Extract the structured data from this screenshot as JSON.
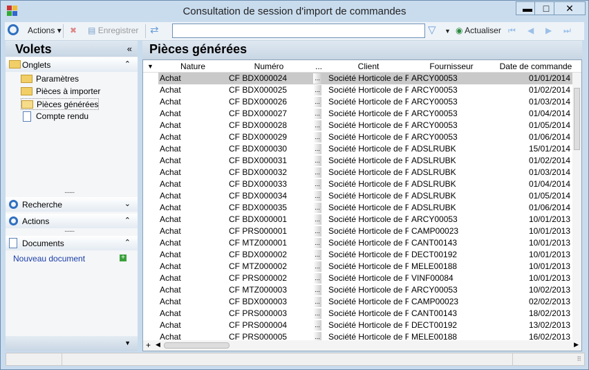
{
  "window": {
    "title": "Consultation de session d'import de commandes",
    "minimize": "▬",
    "maximize": "□",
    "close": "✕"
  },
  "toolbar": {
    "actions": "Actions",
    "delete": "✖",
    "save": "Enregistrer",
    "refresh": "Actualiser",
    "search_value": "",
    "search_placeholder": ""
  },
  "left": {
    "title": "Volets",
    "collapse": "«",
    "onglets": "Onglets",
    "tree": [
      "Paramètres",
      "Pièces à importer",
      "Pièces générées",
      "Compte rendu"
    ],
    "recherche": "Recherche",
    "actions": "Actions",
    "documents": "Documents",
    "new_document": "Nouveau document"
  },
  "main": {
    "title": "Pièces générées",
    "columns": [
      "Nature",
      "Numéro",
      "...",
      "Client",
      "Fournisseur",
      "Date de commande"
    ],
    "rows": [
      [
        "Achat",
        "CF BDX000024",
        "Société Horticole de F",
        "ARCY00053",
        "01/01/2014"
      ],
      [
        "Achat",
        "CF BDX000025",
        "Société Horticole de F",
        "ARCY00053",
        "01/02/2014"
      ],
      [
        "Achat",
        "CF BDX000026",
        "Société Horticole de F",
        "ARCY00053",
        "01/03/2014"
      ],
      [
        "Achat",
        "CF BDX000027",
        "Société Horticole de F",
        "ARCY00053",
        "01/04/2014"
      ],
      [
        "Achat",
        "CF BDX000028",
        "Société Horticole de F",
        "ARCY00053",
        "01/05/2014"
      ],
      [
        "Achat",
        "CF BDX000029",
        "Société Horticole de F",
        "ARCY00053",
        "01/06/2014"
      ],
      [
        "Achat",
        "CF BDX000030",
        "Société Horticole de F",
        "ADSLRUBK",
        "15/01/2014"
      ],
      [
        "Achat",
        "CF BDX000031",
        "Société Horticole de F",
        "ADSLRUBK",
        "01/02/2014"
      ],
      [
        "Achat",
        "CF BDX000032",
        "Société Horticole de F",
        "ADSLRUBK",
        "01/03/2014"
      ],
      [
        "Achat",
        "CF BDX000033",
        "Société Horticole de F",
        "ADSLRUBK",
        "01/04/2014"
      ],
      [
        "Achat",
        "CF BDX000034",
        "Société Horticole de F",
        "ADSLRUBK",
        "01/05/2014"
      ],
      [
        "Achat",
        "CF BDX000035",
        "Société Horticole de F",
        "ADSLRUBK",
        "01/06/2014"
      ],
      [
        "Achat",
        "CF BDX000001",
        "Société Horticole de F",
        "ARCY00053",
        "10/01/2013"
      ],
      [
        "Achat",
        "CF PRS000001",
        "Société Horticole de F",
        "CAMP00023",
        "10/01/2013"
      ],
      [
        "Achat",
        "CF MTZ000001",
        "Société Horticole de F",
        "CANT00143",
        "10/01/2013"
      ],
      [
        "Achat",
        "CF BDX000002",
        "Société Horticole de F",
        "DECT00192",
        "10/01/2013"
      ],
      [
        "Achat",
        "CF MTZ000002",
        "Société Horticole de F",
        "MELE00188",
        "10/01/2013"
      ],
      [
        "Achat",
        "CF PRS000002",
        "Société Horticole de F",
        "VINF00084",
        "10/01/2013"
      ],
      [
        "Achat",
        "CF MTZ000003",
        "Société Horticole de F",
        "ARCY00053",
        "10/02/2013"
      ],
      [
        "Achat",
        "CF BDX000003",
        "Société Horticole de F",
        "CAMP00023",
        "02/02/2013"
      ],
      [
        "Achat",
        "CF PRS000003",
        "Société Horticole de F",
        "CANT00143",
        "18/02/2013"
      ],
      [
        "Achat",
        "CF PRS000004",
        "Société Horticole de F",
        "DECT00192",
        "13/02/2013"
      ],
      [
        "Achat",
        "CF PRS000005",
        "Société Horticole de F",
        "MELE00188",
        "16/02/2013"
      ]
    ]
  }
}
